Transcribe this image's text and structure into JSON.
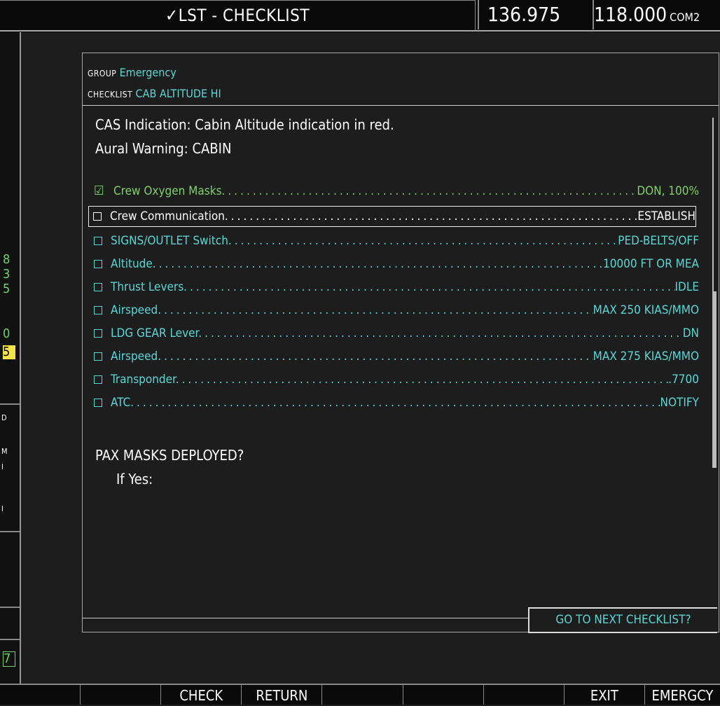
{
  "title": "✓LST - CHECKLIST",
  "freq_active": "136.975",
  "freq_standby": "118.000",
  "com_label": "COM2",
  "left_strip": [
    "8",
    "3",
    "5",
    "0",
    "5",
    "D",
    "M",
    "I",
    "I",
    "7"
  ],
  "group_label": "GROUP",
  "group_value": "Emergency",
  "checklist_label": "CHECKLIST",
  "checklist_value": "CAB ALTITUDE HI",
  "line1": "CAS Indication: Cabin Altitude indication in red.",
  "line2": "Aural Warning: CABIN",
  "items": [
    {
      "name": "Crew Oxygen Masks.",
      "action": "DON, 100%",
      "state": "checked"
    },
    {
      "name": "Crew Communication.",
      "action": "ESTABLISH",
      "state": "selected"
    },
    {
      "name": "SIGNS/OUTLET Switch.",
      "action": "PED-BELTS/OFF",
      "state": "open"
    },
    {
      "name": "Altitude.",
      "action": "10000 FT OR MEA",
      "state": "open"
    },
    {
      "name": "Thrust Levers.",
      "action": "IDLE",
      "state": "open"
    },
    {
      "name": "Airspeed.",
      "action": "MAX 250 KIAS/MMO",
      "state": "open"
    },
    {
      "name": "LDG GEAR Lever.",
      "action": "DN",
      "state": "open"
    },
    {
      "name": "Airspeed.",
      "action": "MAX 275 KIAS/MMO",
      "state": "open"
    },
    {
      "name": "Transponder.",
      "action": ".7700",
      "state": "open"
    },
    {
      "name": "ATC.",
      "action": "NOTIFY",
      "state": "open"
    }
  ],
  "pax_question": "PAX MASKS DEPLOYED?",
  "if_yes": "If Yes:",
  "next_checklist": "GO TO NEXT CHECKLIST?",
  "softkeys": [
    "",
    "",
    "CHECK",
    "RETURN",
    "",
    "",
    "",
    "EXIT",
    "EMERGCY"
  ]
}
